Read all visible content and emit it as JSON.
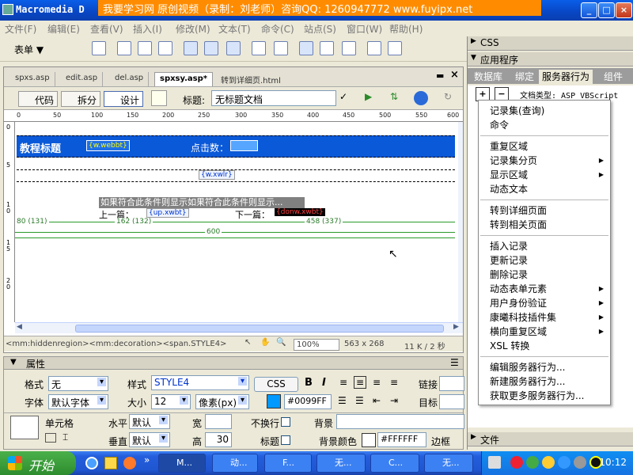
{
  "window": {
    "title": "Macromedia D",
    "banner": "我要学习网 原创视频（录制：刘老师）咨询QQ: 1260947772 www.fuyipx.net",
    "buttons": {
      "minimize": "_",
      "maximize": "□",
      "close": "×"
    }
  },
  "menubar": [
    "文件(F)",
    "编辑(E)",
    "查看(V)",
    "插入(I)",
    "修改(M)",
    "文本(T)",
    "命令(C)",
    "站点(S)",
    "窗口(W)",
    "帮助(H)"
  ],
  "insertbar": {
    "category": "表单"
  },
  "document": {
    "tabs": [
      "spxs.asp",
      "edit.asp",
      "del.asp",
      "spxsy.asp*",
      "转到详细页.html"
    ],
    "active_tab": "spxsy.asp*",
    "views": {
      "code": "代码",
      "split": "拆分",
      "design": "设计"
    },
    "title_label": "标题:",
    "title_value": "无标题文档",
    "ruler_marks": [
      "0",
      "50",
      "100",
      "150",
      "200",
      "250",
      "300",
      "350",
      "400",
      "450",
      "500",
      "550",
      "600"
    ],
    "ruler_left_marks": [
      "0",
      "5",
      "1",
      "0",
      "1",
      "5",
      "2",
      "0"
    ],
    "canvas": {
      "course_title": "教程标题",
      "title_binding": "{w.webbt}",
      "click_label": "点击数：",
      "content_binding": "{w.xwlr}",
      "if_region": "如果符合此条件则显示如果符合此条件则显示...",
      "prev_label": "上一篇：",
      "prev_binding": "{up.xwbt}",
      "next_label": "下一篇：",
      "next_binding": "{donw.xwbt}",
      "col_widths": [
        "80 (131)",
        "162 (132)",
        "458 (337)"
      ],
      "table_width": "600"
    },
    "status": {
      "tags": "<mm:hiddenregion><mm:decoration><span.STYLE4>",
      "zoom": "100%",
      "size": "563 x 268",
      "download": "11 K / 2 秒"
    }
  },
  "properties": {
    "header": "属性",
    "format_label": "格式",
    "format_value": "无",
    "style_label": "样式",
    "style_value": "STYLE4",
    "css_button": "CSS",
    "bold": "B",
    "italic": "I",
    "link_label": "链接",
    "font_label": "字体",
    "font_value": "默认字体",
    "size_label": "大小",
    "size_value": "12",
    "unit_value": "像素(px)",
    "color_value": "#0099FF",
    "target_label": "目标",
    "cell_label": "单元格",
    "horiz_label": "水平",
    "horiz_value": "默认",
    "width_label": "宽",
    "width_value": "",
    "nowrap_label": "不换行",
    "bg_label": "背景",
    "vert_label": "垂直",
    "vert_value": "默认",
    "height_label": "高",
    "height_value": "30",
    "header_cell_label": "标题",
    "bgcolor_label": "背景颜色",
    "bgcolor_value": "#FFFFFF",
    "border_label": "边框"
  },
  "right_panel": {
    "css_header": "CSS",
    "app_header": "应用程序",
    "tabs": [
      "数据库",
      "绑定",
      "服务器行为",
      "组件"
    ],
    "active_tab": "服务器行为",
    "doc_type": "文档类型: ASP VBScript",
    "files_header": "文件"
  },
  "popup_menu": {
    "items": [
      {
        "label": "记录集(查询)",
        "submenu": false
      },
      {
        "label": "命令",
        "submenu": false
      },
      {
        "sep": true
      },
      {
        "label": "重复区域",
        "submenu": false
      },
      {
        "label": "记录集分页",
        "submenu": true
      },
      {
        "label": "显示区域",
        "submenu": true
      },
      {
        "label": "动态文本",
        "submenu": false
      },
      {
        "sep": true
      },
      {
        "label": "转到详细页面",
        "submenu": false
      },
      {
        "label": "转到相关页面",
        "submenu": false
      },
      {
        "sep": true
      },
      {
        "label": "插入记录",
        "submenu": false
      },
      {
        "label": "更新记录",
        "submenu": false
      },
      {
        "label": "删除记录",
        "submenu": false
      },
      {
        "label": "动态表单元素",
        "submenu": true
      },
      {
        "label": "用户身份验证",
        "submenu": true
      },
      {
        "label": "康曦科技插件集",
        "submenu": true
      },
      {
        "label": "横向重复区域",
        "submenu": true
      },
      {
        "label": "XSL 转换",
        "submenu": false
      },
      {
        "sep": true
      },
      {
        "label": "编辑服务器行为...",
        "submenu": false
      },
      {
        "label": "新建服务器行为...",
        "submenu": false
      },
      {
        "label": "获取更多服务器行为...",
        "submenu": false
      }
    ]
  },
  "taskbar": {
    "start": "开始",
    "tasks": [
      "M...",
      "动...",
      "F...",
      "无...",
      "C...",
      "无..."
    ],
    "clock": "10:12"
  }
}
